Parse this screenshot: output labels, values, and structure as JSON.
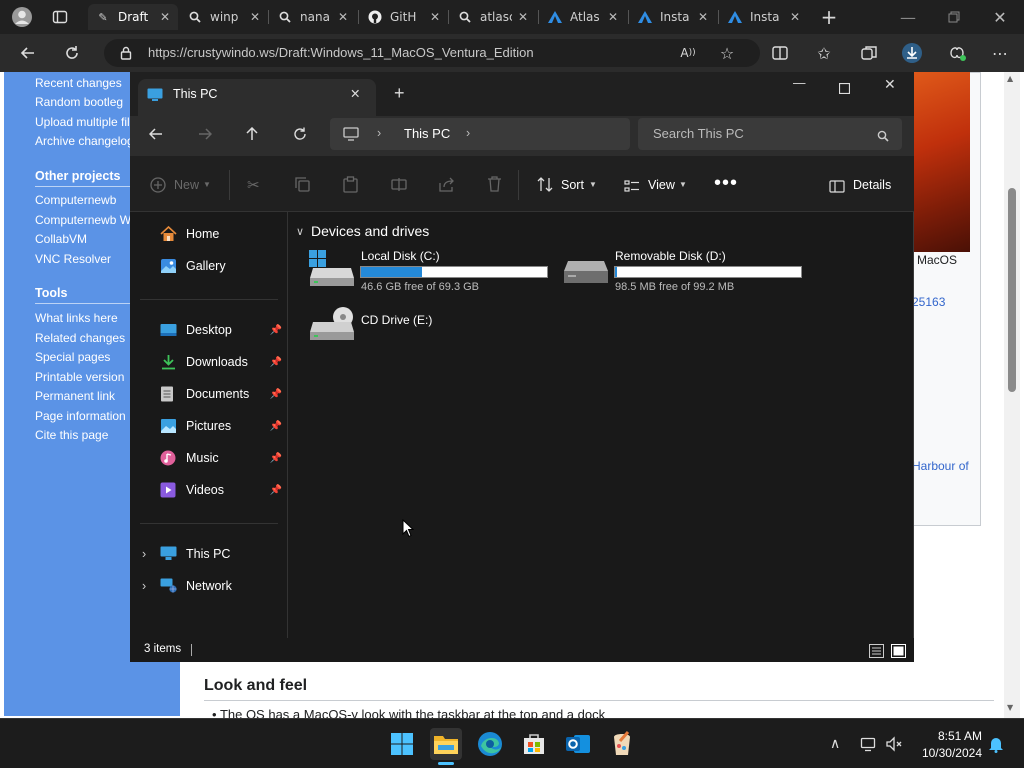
{
  "browser": {
    "tabs": [
      {
        "label": "Draft",
        "icon": "wiki-icon",
        "active": true
      },
      {
        "label": "winp",
        "icon": "search-icon"
      },
      {
        "label": "nana",
        "icon": "search-icon"
      },
      {
        "label": "GitH",
        "icon": "github-icon"
      },
      {
        "label": "atlasc",
        "icon": "search-icon"
      },
      {
        "label": "Atlas",
        "icon": "atlas-icon"
      },
      {
        "label": "Insta",
        "icon": "atlas-icon"
      },
      {
        "label": "Insta",
        "icon": "atlas-icon"
      }
    ],
    "url": "https://crustywindo.ws/Draft:Windows_11_MacOS_Ventura_Edition"
  },
  "wiki": {
    "sidebar_links_top": [
      "Recent changes",
      "Random bootleg",
      "Upload multiple file",
      "Archive changelog"
    ],
    "other_projects_heading": "Other projects",
    "other_projects": [
      "Computernewb",
      "Computernewb Wi",
      "CollabVM",
      "VNC Resolver"
    ],
    "tools_heading": "Tools",
    "tools": [
      "What links here",
      "Related changes",
      "Special pages",
      "Printable version",
      "Permanent link",
      "Page information",
      "Cite this page"
    ],
    "infobox_text1": "MacOS",
    "infobox_text2": "25163",
    "infobox_text3": "Harbour of",
    "section_heading": "Look and feel",
    "bullet_text": "The OS has a MacOS-y look with the taskbar at the top and a dock"
  },
  "explorer": {
    "tab_title": "This PC",
    "breadcrumb": "This PC",
    "search_placeholder": "Search This PC",
    "toolbar": {
      "new": "New",
      "sort": "Sort",
      "view": "View",
      "details": "Details"
    },
    "nav": {
      "home": "Home",
      "gallery": "Gallery",
      "quick_access": [
        "Desktop",
        "Downloads",
        "Documents",
        "Pictures",
        "Music",
        "Videos"
      ],
      "this_pc": "This PC",
      "network": "Network"
    },
    "section_title": "Devices and drives",
    "drives": [
      {
        "name": "Local Disk (C:)",
        "free": "46.6 GB free of 69.3 GB",
        "used_fraction": 0.33
      },
      {
        "name": "Removable Disk (D:)",
        "free": "98.5 MB free of 99.2 MB",
        "used_fraction": 0.01
      },
      {
        "name": "CD Drive (E:)"
      }
    ],
    "status": "3 items"
  },
  "taskbar": {
    "time": "8:51 AM",
    "date": "10/30/2024"
  },
  "colors": {
    "accent": "#2489d8",
    "wiki_sidebar": "#5b93e6"
  }
}
